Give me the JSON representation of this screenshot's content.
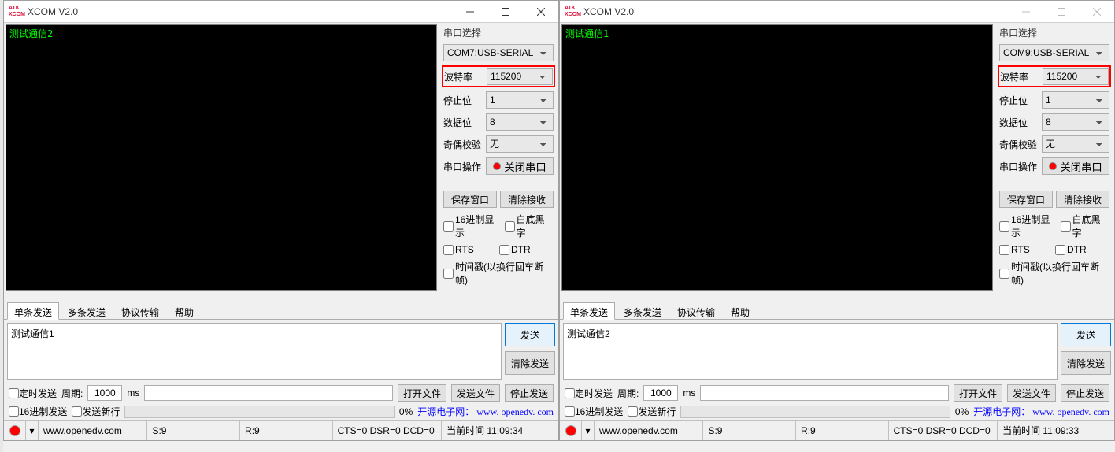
{
  "windows": [
    {
      "title": "XCOM V2.0",
      "terminal_text": "测试通信2",
      "port": {
        "section_label": "串口选择",
        "device": "COM7:USB-SERIAL",
        "baud_label": "波特率",
        "baud_value": "115200",
        "stop_label": "停止位",
        "stop_value": "1",
        "data_label": "数据位",
        "data_value": "8",
        "parity_label": "奇偶校验",
        "parity_value": "无",
        "op_label": "串口操作",
        "op_btn": "关闭串口"
      },
      "buttons": {
        "save_window": "保存窗口",
        "clear_recv": "清除接收",
        "hex_display": "16进制显示",
        "white_bg": "白底黑字",
        "rts": "RTS",
        "dtr": "DTR",
        "timestamp": "时间戳(以换行回车断帧)"
      },
      "tabs": [
        "单条发送",
        "多条发送",
        "协议传输",
        "帮助"
      ],
      "send_text": "测试通信1",
      "send_btn": "发送",
      "clear_send_btn": "清除发送",
      "timed_send": "定时发送",
      "period_label": "周期:",
      "period_value": "1000",
      "period_unit": "ms",
      "open_file": "打开文件",
      "send_file": "发送文件",
      "stop_send": "停止发送",
      "hex_send": "16进制发送",
      "send_newline": "发送新行",
      "progress_pct": "0%",
      "link_text": "开源电子网： www. openedv. com",
      "status": {
        "url": "www.openedv.com",
        "s": "S:9",
        "r": "R:9",
        "cts": "CTS=0 DSR=0 DCD=0",
        "time": "当前时间 11:09:34"
      }
    },
    {
      "title": "XCOM V2.0",
      "terminal_text": "测试通信1",
      "port": {
        "section_label": "串口选择",
        "device": "COM9:USB-SERIAL",
        "baud_label": "波特率",
        "baud_value": "115200",
        "stop_label": "停止位",
        "stop_value": "1",
        "data_label": "数据位",
        "data_value": "8",
        "parity_label": "奇偶校验",
        "parity_value": "无",
        "op_label": "串口操作",
        "op_btn": "关闭串口"
      },
      "buttons": {
        "save_window": "保存窗口",
        "clear_recv": "清除接收",
        "hex_display": "16进制显示",
        "white_bg": "白底黑字",
        "rts": "RTS",
        "dtr": "DTR",
        "timestamp": "时间戳(以换行回车断帧)"
      },
      "tabs": [
        "单条发送",
        "多条发送",
        "协议传输",
        "帮助"
      ],
      "send_text": "测试通信2",
      "send_btn": "发送",
      "clear_send_btn": "清除发送",
      "timed_send": "定时发送",
      "period_label": "周期:",
      "period_value": "1000",
      "period_unit": "ms",
      "open_file": "打开文件",
      "send_file": "发送文件",
      "stop_send": "停止发送",
      "hex_send": "16进制发送",
      "send_newline": "发送新行",
      "progress_pct": "0%",
      "link_text": "开源电子网： www. openedv. com",
      "status": {
        "url": "www.openedv.com",
        "s": "S:9",
        "r": "R:9",
        "cts": "CTS=0 DSR=0 DCD=0",
        "time": "当前时间 11:09:33"
      }
    }
  ]
}
